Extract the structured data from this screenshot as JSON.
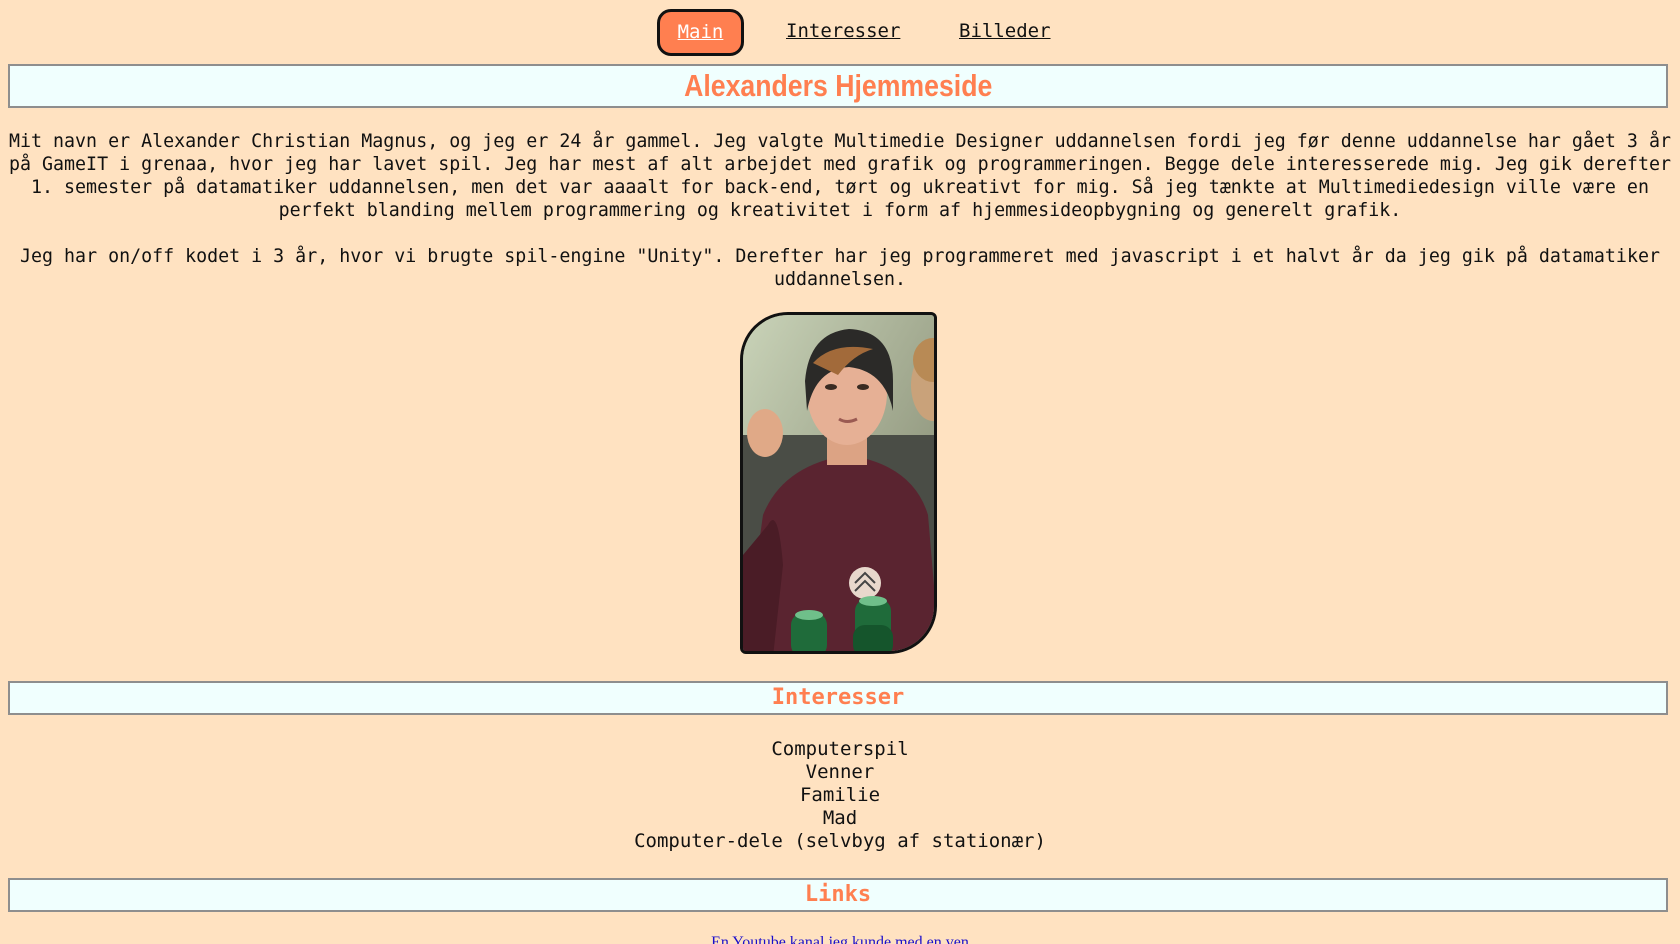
{
  "nav": {
    "items": [
      {
        "label": "Main",
        "active": true
      },
      {
        "label": "Interesser",
        "active": false
      },
      {
        "label": "Billeder",
        "active": false
      }
    ]
  },
  "page_title": "Alexanders Hjemmeside",
  "intro": {
    "paragraphs": [
      "Mit navn er Alexander Christian Magnus, og jeg er 24 år gammel. Jeg valgte Multimedie Designer uddannelsen fordi jeg før denne uddannelse har gået 3 år på GameIT i grenaa, hvor jeg har lavet spil. Jeg har mest af alt arbejdet med grafik og programmeringen. Begge dele interesserede mig. Jeg gik derefter 1. semester på datamatiker uddannelsen, men det var aaaalt for back-end, tørt og ukreativt for mig. Så jeg tænkte at Multimediedesign ville være en perfekt blanding mellem programmering og kreativitet i form af hjemmesideopbygning og generelt grafik.",
      "Jeg har on/off kodet i 3 år, hvor vi brugte spil-engine \"Unity\". Derefter har jeg programmeret med javascript i et halvt år da jeg gik på datamatiker uddannelsen."
    ]
  },
  "sections": {
    "interests_heading": "Interesser",
    "interests": [
      "Computerspil",
      "Venner",
      "Familie",
      "Mad",
      "Computer-dele (selvbyg af stationær)"
    ],
    "links_heading": "Links",
    "links": [
      "En Youtube kanal jeg kunde med en ven"
    ]
  },
  "colors": {
    "background": "#ffe2c1",
    "accent": "#ff7f50",
    "band": "#f0fffe",
    "link": "#1a0dcc"
  }
}
